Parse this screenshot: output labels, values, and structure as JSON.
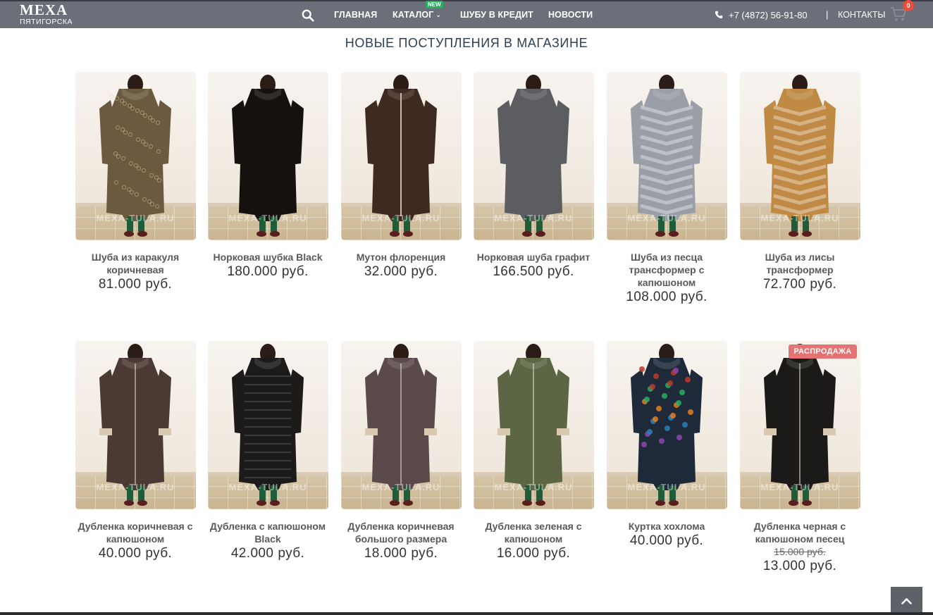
{
  "header": {
    "logo_main": "МЕХА",
    "logo_sub": "ПЯТИГОРСКА",
    "nav": [
      {
        "label": "ГЛАВНАЯ"
      },
      {
        "label": "КАТАЛОГ"
      },
      {
        "label": "ШУБУ В КРЕДИТ"
      },
      {
        "label": "НОВОСТИ"
      }
    ],
    "catalog_badge": "NEW",
    "phone": "+7 (4872) 56-91-80",
    "separator": "|",
    "contacts": "КОНТАКТЫ",
    "cart_count": "0"
  },
  "section": {
    "title": "НОВЫЕ ПОСТУПЛЕНИЯ В МАГАЗИНЕ"
  },
  "currency": "руб.",
  "watermark": "MEXA-TULA.RU",
  "sale_label": "РАСПРОДАЖА",
  "products": [
    {
      "name": "Шуба из каракуля коричневая",
      "price": "81.000",
      "coat_color": "#6b5a40",
      "texture": "curly"
    },
    {
      "name": "Норковая шубка Black",
      "price": "180.000",
      "coat_color": "#15110f",
      "texture": "smooth"
    },
    {
      "name": "Мутон флоренция",
      "price": "32.000",
      "coat_color": "#3e2a20",
      "texture": "fur"
    },
    {
      "name": "Норковая шуба графит",
      "price": "166.500",
      "coat_color": "#5c5d60",
      "texture": "smooth"
    },
    {
      "name": "Шуба из песца трансформер с капюшоном",
      "price": "108.000",
      "coat_color": "#9a9ea6",
      "texture": "chevron"
    },
    {
      "name": "Шуба из лисы трансформер",
      "price": "72.700",
      "coat_color": "#c08a45",
      "texture": "chevron"
    },
    {
      "name": "Дубленка коричневая с капюшоном",
      "price": "40.000",
      "coat_color": "#4a3a33",
      "texture": "leather"
    },
    {
      "name": "Дубленка с капюшоном Black",
      "price": "42.000",
      "coat_color": "#1c1b19",
      "texture": "quilted"
    },
    {
      "name": "Дубленка коричневая большого размера",
      "price": "18.000",
      "coat_color": "#5a4a4c",
      "texture": "leather"
    },
    {
      "name": "Дубленка зеленая с капюшоном",
      "price": "16.000",
      "coat_color": "#5d6644",
      "texture": "leather"
    },
    {
      "name": "Куртка хохлома",
      "price": "40.000",
      "coat_color": "#1e2a3a",
      "texture": "floral"
    },
    {
      "name": "Дубленка черная с капюшоном песец",
      "price": "13.000",
      "old_price": "15.000",
      "coat_color": "#1b1a18",
      "texture": "leather",
      "sale": true
    }
  ]
}
